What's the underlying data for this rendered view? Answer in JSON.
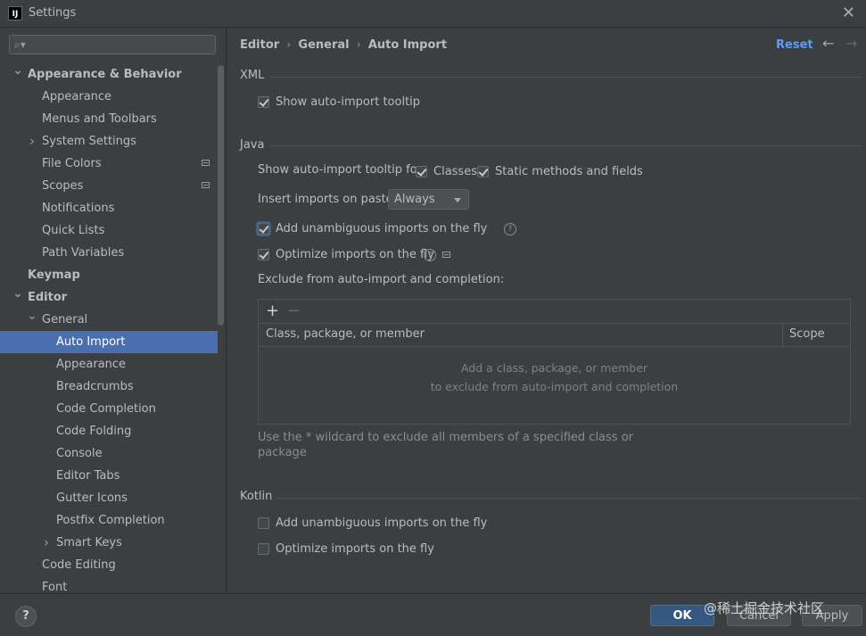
{
  "window": {
    "title": "Settings",
    "app_icon_text": "IJ"
  },
  "search": {
    "placeholder": ""
  },
  "sidebar": {
    "items": [
      {
        "label": "Appearance & Behavior",
        "bold": true,
        "arrow": "down"
      },
      {
        "label": "Appearance"
      },
      {
        "label": "Menus and Toolbars"
      },
      {
        "label": "System Settings",
        "arrow": "right"
      },
      {
        "label": "File Colors",
        "badge": true
      },
      {
        "label": "Scopes",
        "badge": true
      },
      {
        "label": "Notifications"
      },
      {
        "label": "Quick Lists"
      },
      {
        "label": "Path Variables"
      },
      {
        "label": "Keymap",
        "bold": true
      },
      {
        "label": "Editor",
        "bold": true,
        "arrow": "down"
      },
      {
        "label": "General",
        "arrow": "down"
      },
      {
        "label": "Auto Import",
        "selected": true
      },
      {
        "label": "Appearance"
      },
      {
        "label": "Breadcrumbs"
      },
      {
        "label": "Code Completion"
      },
      {
        "label": "Code Folding"
      },
      {
        "label": "Console"
      },
      {
        "label": "Editor Tabs"
      },
      {
        "label": "Gutter Icons"
      },
      {
        "label": "Postfix Completion"
      },
      {
        "label": "Smart Keys",
        "arrow": "right"
      },
      {
        "label": "Code Editing"
      },
      {
        "label": "Font"
      }
    ]
  },
  "header": {
    "breadcrumb": [
      "Editor",
      "General",
      "Auto Import"
    ],
    "separator": "›",
    "reset_label": "Reset",
    "back_icon": "←",
    "forward_icon": "→"
  },
  "xml": {
    "title": "XML",
    "show_tooltip": {
      "label": "Show auto-import tooltip",
      "checked": true
    }
  },
  "java": {
    "title": "Java",
    "tooltip_for_label": "Show auto-import tooltip for:",
    "classes": {
      "label": "Classes",
      "checked": true
    },
    "static_methods": {
      "label": "Static methods and fields",
      "checked": true
    },
    "insert_on_paste_label": "Insert imports on paste:",
    "insert_on_paste_value": "Always",
    "add_unambiguous": {
      "label": "Add unambiguous imports on the fly",
      "checked": true
    },
    "optimize_imports": {
      "label": "Optimize imports on the fly",
      "checked": true
    },
    "exclude_label": "Exclude from auto-import and completion:",
    "add_icon": "+",
    "remove_icon": "−",
    "table": {
      "col_member": "Class, package, or member",
      "col_scope": "Scope",
      "empty_line1": "Add a class, package, or member",
      "empty_line2": "to exclude from auto-import and completion"
    },
    "hint_line1": "Use the * wildcard to exclude all members of a specified class or",
    "hint_line2": "package"
  },
  "kotlin": {
    "title": "Kotlin",
    "add_unambiguous": {
      "label": "Add unambiguous imports on the fly",
      "checked": false
    },
    "optimize_imports": {
      "label": "Optimize imports on the fly",
      "checked": false
    }
  },
  "footer": {
    "help_label": "?",
    "ok_label": "OK",
    "cancel_label": "Cancel",
    "apply_label": "Apply",
    "watermark": "@稀土掘金技术社区"
  }
}
